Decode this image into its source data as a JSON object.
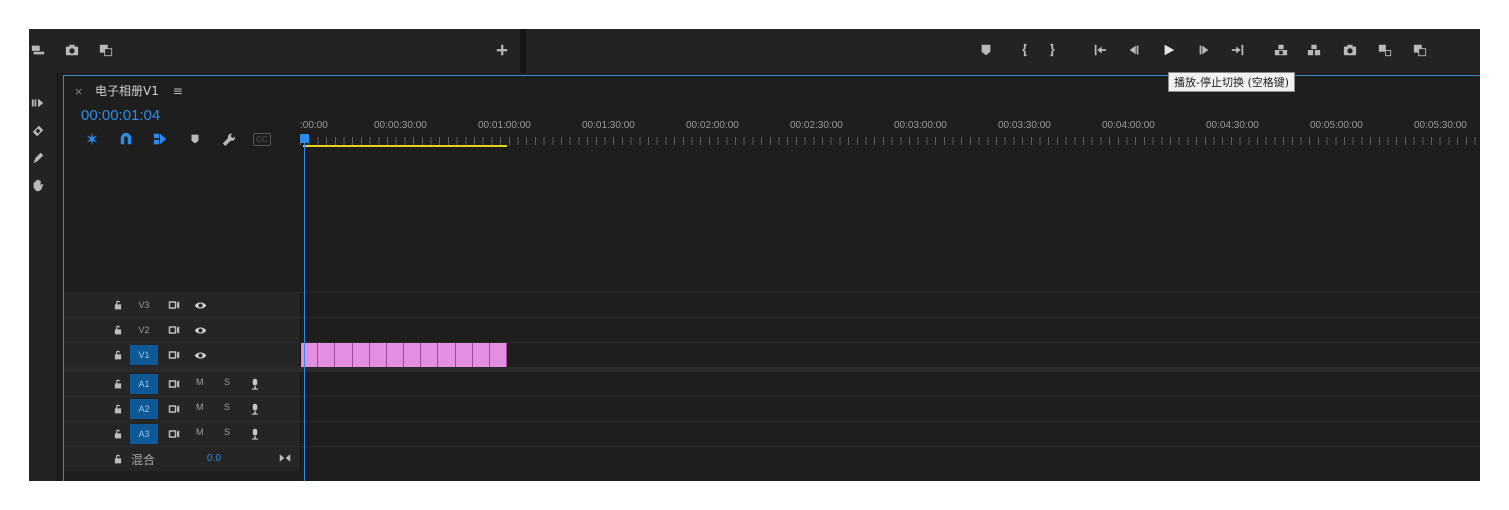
{
  "tooltip": "播放-停止切换 (空格键)",
  "sequence": {
    "close_glyph": "×",
    "name": "电子相册V1",
    "menu_glyph": "≡",
    "timecode": "00:00:01:04"
  },
  "ruler": {
    "labels": [
      ":00:00",
      "00:00:30:00",
      "00:01:00:00",
      "00:01:30:00",
      "00:02:00:00",
      "00:02:30:00",
      "00:03:00:00",
      "00:03:30:00",
      "00:04:00:00",
      "00:04:30:00",
      "00:05:00:00",
      "00:05:30:00"
    ]
  },
  "tracks": {
    "video": [
      {
        "name": "V3",
        "active": false
      },
      {
        "name": "V2",
        "active": false
      },
      {
        "name": "V1",
        "active": true
      }
    ],
    "audio": [
      {
        "name": "A1",
        "active": true,
        "mute": "M",
        "solo": "S"
      },
      {
        "name": "A2",
        "active": true,
        "mute": "M",
        "solo": "S"
      },
      {
        "name": "A3",
        "active": true,
        "mute": "M",
        "solo": "S"
      }
    ],
    "mix": {
      "label": "混合",
      "value": "0.0"
    }
  },
  "clips": {
    "count": 12,
    "color": "#e38ee0"
  },
  "header_controls": {
    "cc_label": "CC"
  },
  "colors": {
    "accent": "#2d8ceb",
    "clip": "#e38ee0",
    "workarea": "#e6d21c",
    "track_active": "#0d5896"
  }
}
